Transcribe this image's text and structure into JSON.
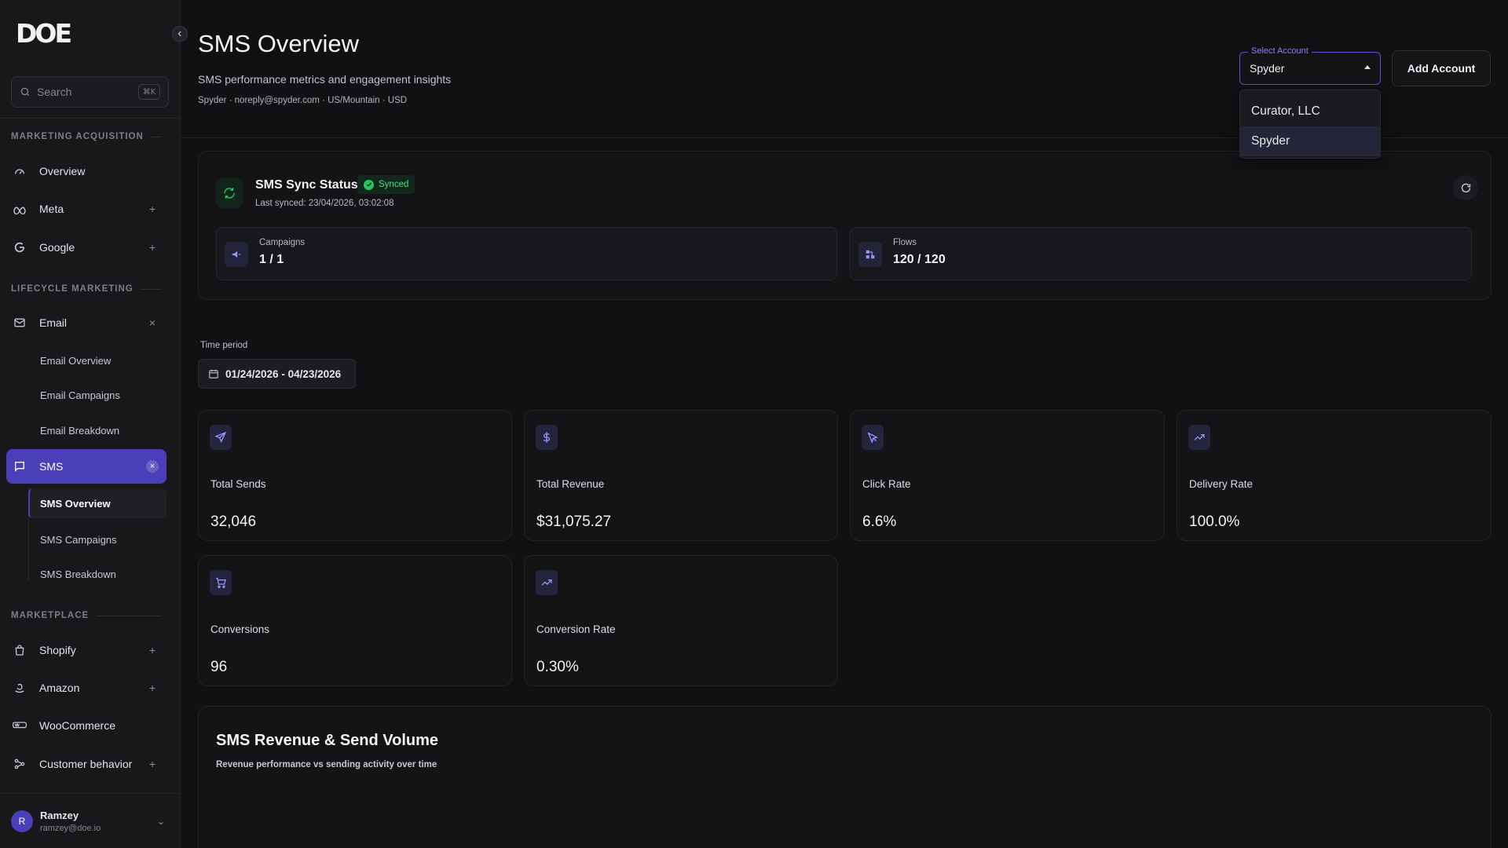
{
  "brand": {
    "logo_text": "DOE"
  },
  "search": {
    "placeholder": "Search",
    "shortcut": "⌘K"
  },
  "sidebar": {
    "sections": {
      "marketing": "MARKETING ACQUISITION",
      "lifecycle": "LIFECYCLE MARKETING",
      "marketplace": "MARKETPLACE"
    },
    "items": {
      "overview": "Overview",
      "meta": "Meta",
      "google": "Google",
      "email": "Email",
      "email_overview": "Email Overview",
      "email_campaigns": "Email Campaigns",
      "email_breakdown": "Email Breakdown",
      "sms": "SMS",
      "sms_overview": "SMS Overview",
      "sms_campaigns": "SMS Campaigns",
      "sms_breakdown": "SMS Breakdown",
      "shopify": "Shopify",
      "amazon": "Amazon",
      "woocommerce": "WooCommerce",
      "customer_behavior": "Customer behavior"
    }
  },
  "user": {
    "initial": "R",
    "name": "Ramzey",
    "email": "ramzey@doe.io"
  },
  "header": {
    "title": "SMS Overview",
    "subtitle": "SMS performance metrics and engagement insights",
    "meta": "Spyder · noreply@spyder.com · US/Mountain · USD"
  },
  "account_select": {
    "label": "Select Account",
    "value": "Spyder",
    "options": [
      "Curator, LLC",
      "Spyder"
    ]
  },
  "add_account_label": "Add Account",
  "sync": {
    "title": "SMS Sync Status",
    "badge": "Synced",
    "last_synced": "Last synced: 23/04/2026, 03:02:08",
    "campaigns_label": "Campaigns",
    "campaigns_value": "1 / 1",
    "flows_label": "Flows",
    "flows_value": "120 / 120"
  },
  "time_period": {
    "label": "Time period",
    "value": "01/24/2026 - 04/23/2026"
  },
  "metrics": [
    {
      "label": "Total Sends",
      "value": "32,046",
      "icon": "send-icon"
    },
    {
      "label": "Total Revenue",
      "value": "$31,075.27",
      "icon": "dollar-icon"
    },
    {
      "label": "Click Rate",
      "value": "6.6%",
      "icon": "cursor-icon"
    },
    {
      "label": "Delivery Rate",
      "value": "100.0%",
      "icon": "trending-up-icon"
    },
    {
      "label": "Conversions",
      "value": "96",
      "icon": "cart-icon"
    },
    {
      "label": "Conversion Rate",
      "value": "0.30%",
      "icon": "trending-up-icon"
    }
  ],
  "chart": {
    "title": "SMS Revenue & Send Volume",
    "subtitle": "Revenue performance vs sending activity over time"
  },
  "colors": {
    "accent": "#4a3fb8",
    "success": "#22c55e",
    "background": "#111113"
  }
}
